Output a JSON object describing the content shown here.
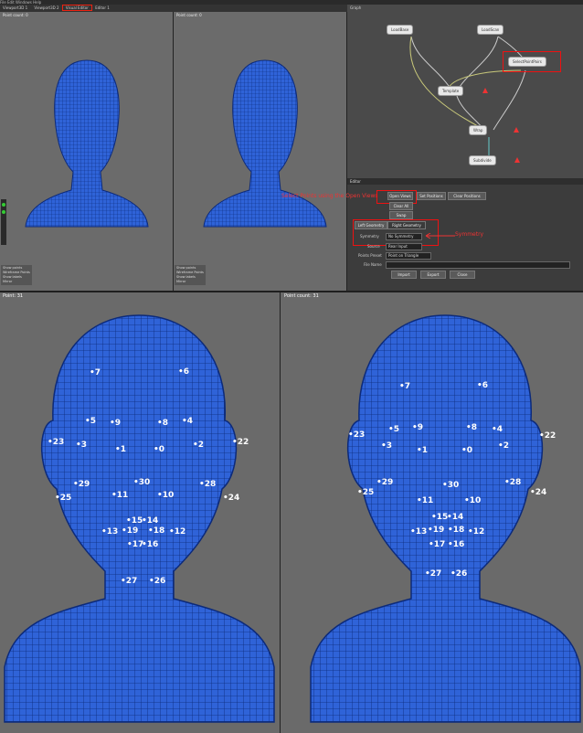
{
  "menubar": {
    "items": [
      "File",
      "Edit",
      "Windows",
      "Help"
    ]
  },
  "tabbar": {
    "tabs": [
      "Viewport3D 1",
      "Viewport3D 2",
      "Visual Editor",
      "Editor 1"
    ]
  },
  "viewports_top": [
    {
      "title": "Point count: 0"
    },
    {
      "title": "Point count: 0"
    }
  ],
  "viewport_options": {
    "items": [
      "Show points",
      "Wireframe Points",
      "Show labels",
      "Mirror"
    ]
  },
  "graph": {
    "title": "Graph",
    "nodes": [
      {
        "label": "LoadBase"
      },
      {
        "label": "LoadScan"
      },
      {
        "label": "SelectPointPairs"
      },
      {
        "label": "Template"
      },
      {
        "label": "Wrap"
      },
      {
        "label": "Subdivide"
      }
    ]
  },
  "editor": {
    "title": "Editor",
    "buttons": {
      "open_views": "Open Views",
      "set_positions": "Set Positions",
      "clear_positions": "Clear Positions",
      "clear_all": "Clear All",
      "swap": "Swap",
      "left_geometry": "Left Geometry",
      "right_geometry": "Right Geometry",
      "import": "Import",
      "export": "Export",
      "close": "Close"
    },
    "fields": {
      "symmetry_label": "Symmetry",
      "symmetry_value": "No Symmetry",
      "source_label": "Source",
      "source_value": "Rear Input",
      "points_preset_label": "Points Preset",
      "points_preset_value": "Point on Triangle",
      "file_name_label": "File Name"
    },
    "annotation_open": "Select Points using the Open Views",
    "annotation_symmetry": "Symmetry"
  },
  "bottom": {
    "left_title": "Point: 31",
    "right_title": "Point count: 31",
    "landmarks": [
      "0",
      "1",
      "2",
      "3",
      "4",
      "5",
      "6",
      "7",
      "8",
      "9",
      "10",
      "11",
      "12",
      "13",
      "14",
      "15",
      "16",
      "17",
      "18",
      "19",
      "22",
      "23",
      "24",
      "25",
      "26",
      "27",
      "28",
      "29",
      "30"
    ]
  }
}
